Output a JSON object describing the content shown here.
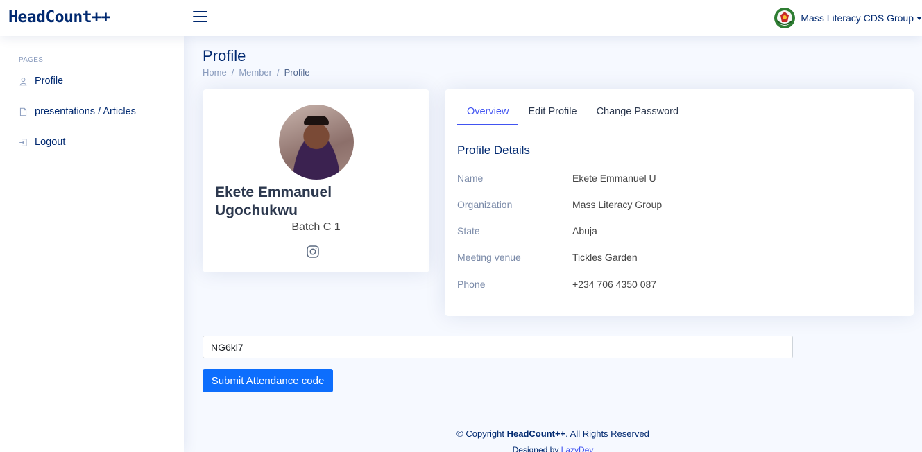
{
  "header": {
    "logo": "HeadCount++",
    "user_name": "Mass Literacy CDS Group"
  },
  "sidebar": {
    "heading": "PAGES",
    "items": [
      {
        "label": "Profile",
        "icon": "person-icon"
      },
      {
        "label": "presentations / Articles",
        "icon": "file-icon"
      },
      {
        "label": "Logout",
        "icon": "logout-icon"
      }
    ]
  },
  "page": {
    "title": "Profile",
    "breadcrumb": [
      "Home",
      "Member",
      "Profile"
    ]
  },
  "profile_card": {
    "name": "Ekete Emmanuel Ugochukwu",
    "batch": "Batch C 1",
    "social_icon": "instagram-icon"
  },
  "details": {
    "tabs": [
      "Overview",
      "Edit Profile",
      "Change Password"
    ],
    "active_tab": "Overview",
    "section_title": "Profile Details",
    "rows": [
      {
        "label": "Name",
        "value": "Ekete Emmanuel U"
      },
      {
        "label": "Organization",
        "value": "Mass Literacy Group"
      },
      {
        "label": "State",
        "value": "Abuja"
      },
      {
        "label": "Meeting venue",
        "value": "Tickles Garden"
      },
      {
        "label": "Phone",
        "value": "+234 706 4350 087"
      }
    ]
  },
  "attendance": {
    "code_value": "NG6kl7",
    "submit_label": "Submit Attendance code"
  },
  "footer": {
    "copyright_prefix": "© Copyright ",
    "brand": "HeadCount++",
    "copyright_suffix": ". All Rights Reserved",
    "designed_by": "Designed by ",
    "designer": "LazyDev"
  },
  "colors": {
    "primary": "#012970",
    "accent": "#4154f1",
    "button": "#0d6efd",
    "background": "#f6f9ff"
  }
}
